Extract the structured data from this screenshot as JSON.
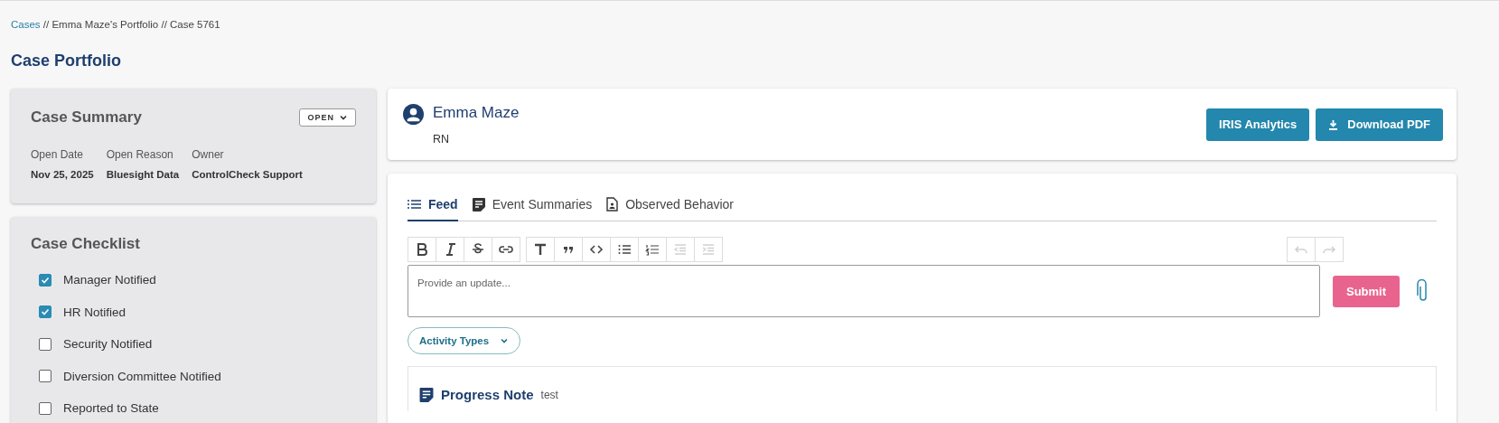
{
  "breadcrumb": {
    "link": "Cases",
    "rest": " // Emma Maze's Portfolio // Case 5761"
  },
  "page_title": "Case Portfolio",
  "case_summary": {
    "title": "Case Summary",
    "status": "OPEN",
    "fields": [
      {
        "label": "Open Date",
        "value": "Nov 25, 2025"
      },
      {
        "label": "Open Reason",
        "value": "Bluesight Data"
      },
      {
        "label": "Owner",
        "value": "ControlCheck Support"
      }
    ]
  },
  "checklist": {
    "title": "Case Checklist",
    "items": [
      {
        "label": "Manager Notified",
        "checked": true
      },
      {
        "label": "HR Notified",
        "checked": true
      },
      {
        "label": "Security Notified",
        "checked": false
      },
      {
        "label": "Diversion Committee Notified",
        "checked": false
      },
      {
        "label": "Reported to State",
        "checked": false
      }
    ]
  },
  "profile": {
    "name": "Emma Maze",
    "role": "RN",
    "buttons": [
      {
        "label": "IRIS Analytics",
        "kind": "plain"
      },
      {
        "label": "Download PDF",
        "kind": "download"
      }
    ]
  },
  "tabs": [
    {
      "label": "Feed",
      "selected": true
    },
    {
      "label": "Event Summaries",
      "selected": false
    },
    {
      "label": "Observed Behavior",
      "selected": false
    }
  ],
  "toolbar": [
    [
      {
        "disabled": false
      },
      {
        "disabled": false
      },
      {
        "disabled": false
      },
      {
        "disabled": false
      }
    ],
    [
      {
        "disabled": false
      },
      {
        "disabled": false
      },
      {
        "disabled": false
      },
      {
        "disabled": false
      },
      {
        "disabled": false
      },
      {
        "disabled": true
      },
      {
        "disabled": true
      }
    ]
  ],
  "history": [
    {
      "disabled": true
    },
    {
      "disabled": true
    }
  ],
  "editor": {
    "placeholder": "Provide an update..."
  },
  "submit": "Submit",
  "filter": "Activity Types",
  "feed": [
    {
      "title": "Progress Note",
      "note": "test"
    }
  ]
}
